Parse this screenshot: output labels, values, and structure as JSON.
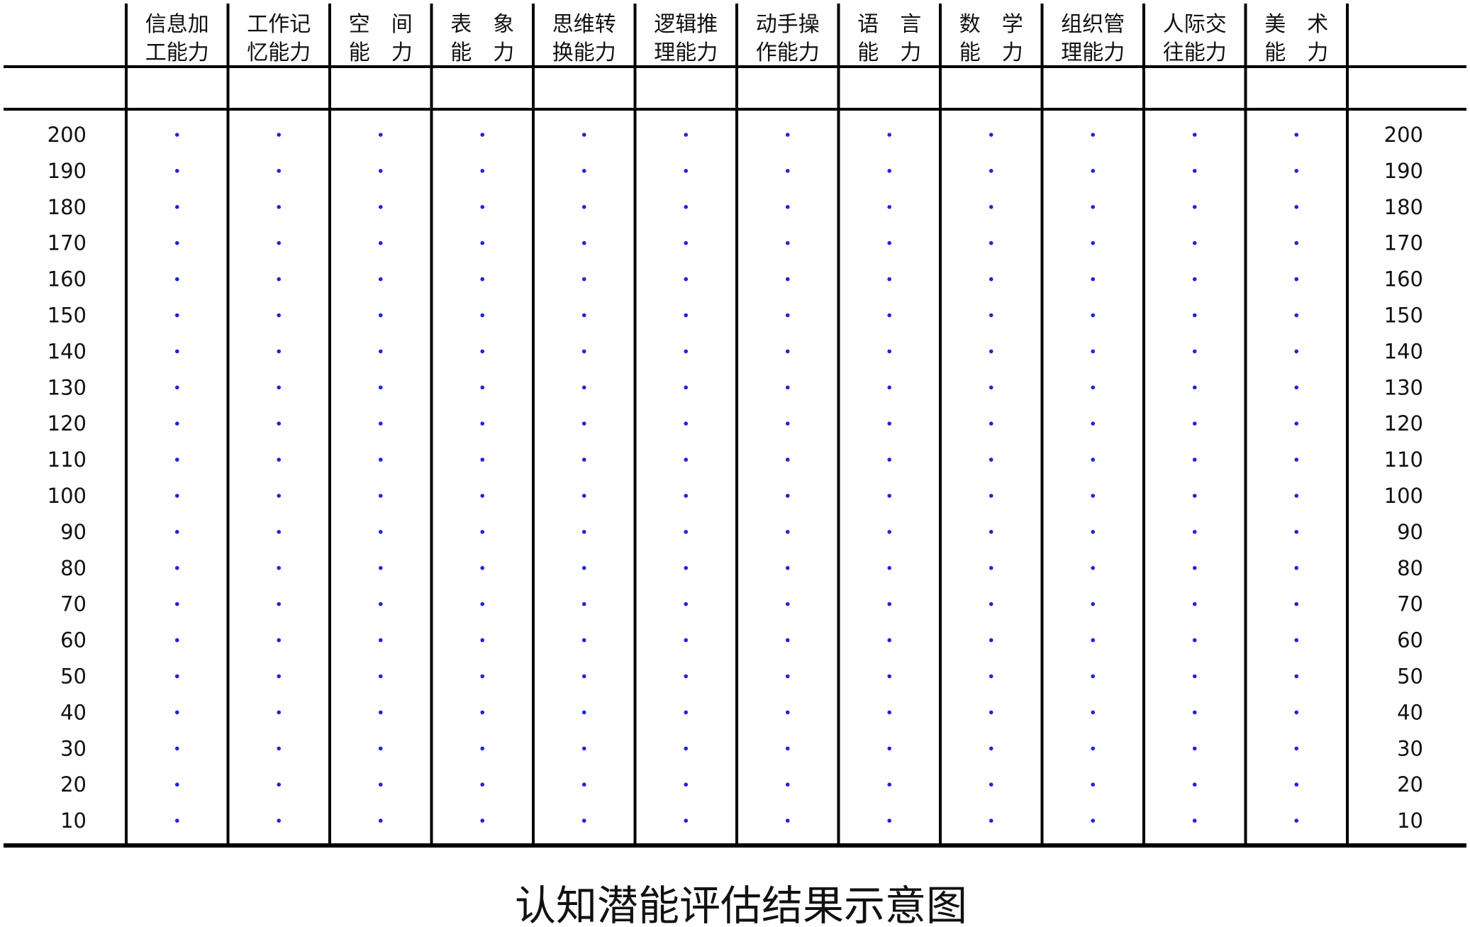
{
  "chart_data": {
    "type": "table",
    "title": "认知潜能评估结果示意图",
    "columns": [
      {
        "line1": "信息加",
        "line2": "工能力"
      },
      {
        "line1": "工作记",
        "line2": "忆能力"
      },
      {
        "line1": "空　间",
        "line2": "能　力"
      },
      {
        "line1": "表　象",
        "line2": "能　力"
      },
      {
        "line1": "思维转",
        "line2": "换能力"
      },
      {
        "line1": "逻辑推",
        "line2": "理能力"
      },
      {
        "line1": "动手操",
        "line2": "作能力"
      },
      {
        "line1": "语　言",
        "line2": "能　力"
      },
      {
        "line1": "数　学",
        "line2": "能　力"
      },
      {
        "line1": "组织管",
        "line2": "理能力"
      },
      {
        "line1": "人际交",
        "line2": "往能力"
      },
      {
        "line1": "美　术",
        "line2": "能　力"
      }
    ],
    "scale": [
      "200",
      "190",
      "180",
      "170",
      "160",
      "150",
      "140",
      "130",
      "120",
      "110",
      "100",
      "90",
      "80",
      "70",
      "60",
      "50",
      "40",
      "30",
      "20",
      "10"
    ],
    "colors": {
      "grid": "#000000",
      "dot": "#2222dd",
      "text": "#111111"
    }
  }
}
